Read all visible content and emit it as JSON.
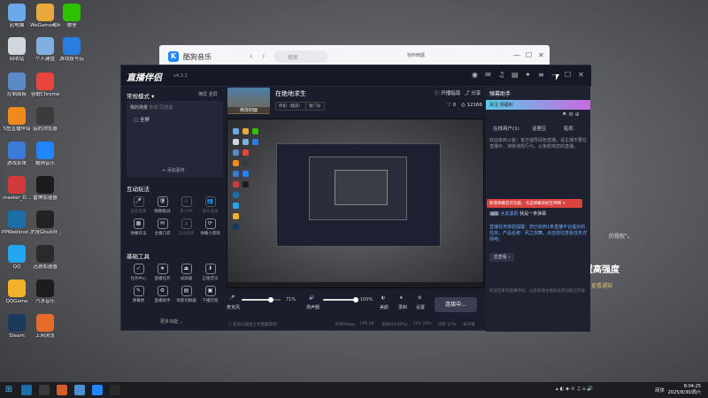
{
  "desktop_icons": [
    {
      "label": "此电脑",
      "icon": "computer-icon",
      "color": "#6aa9e9"
    },
    {
      "label": "WeGame都网专版",
      "icon": "wegame-icon",
      "color": "#e9a83a"
    },
    {
      "label": "微信",
      "icon": "wechat-icon",
      "color": "#2dc100"
    },
    {
      "label": "回收站",
      "icon": "recycle-bin-icon",
      "color": "#cfd6de"
    },
    {
      "label": "个人建盘",
      "icon": "folder-icon",
      "color": "#7fb0e0"
    },
    {
      "label": "游戏租号玩",
      "icon": "rent-game-icon",
      "color": "#2a7de1"
    },
    {
      "label": "控制面板",
      "icon": "control-panel-icon",
      "color": "#5b8ac9"
    },
    {
      "label": "谷歌Chrome",
      "icon": "chrome-icon",
      "color": "#e8453c"
    },
    {
      "label": "S鱼直播伴侣",
      "icon": "douyu-icon",
      "color": "#f08a1d"
    },
    {
      "label": "猎豹浏览器",
      "icon": "browser-icon",
      "color": "#3b3b3b"
    },
    {
      "label": "游戏菜单",
      "icon": "game-menu-icon",
      "color": "#3a7ad9"
    },
    {
      "label": "酷狗音乐",
      "icon": "kugou-icon",
      "color": "#1f86ff"
    },
    {
      "label": "master_D...",
      "icon": "master-icon",
      "color": "#d23b3b"
    },
    {
      "label": "雷神加速器",
      "icon": "leishen-icon",
      "color": "#1b1b1b"
    },
    {
      "label": "PPWeblinst...",
      "icon": "steam-icon",
      "color": "#1b6fa8"
    },
    {
      "label": "罗技Ghub补丁",
      "icon": "ghub-icon",
      "color": "#222"
    },
    {
      "label": "QQ",
      "icon": "qq-icon",
      "color": "#23a6f0"
    },
    {
      "label": "迅游加速器",
      "icon": "xunyou-icon",
      "color": "#2a2a2a"
    },
    {
      "label": "QQGame",
      "icon": "qqgame-icon",
      "color": "#f1b12b"
    },
    {
      "label": "汽水音乐",
      "icon": "qishui-icon",
      "color": "#1c1c1c"
    },
    {
      "label": "Steam",
      "icon": "steam-icon",
      "color": "#1a3a5c"
    },
    {
      "label": "上网浏览",
      "icon": "globe-icon",
      "color": "#e96b2b"
    }
  ],
  "kugou": {
    "title": "酷狗音乐",
    "search_placeholder": "搜索",
    "user": "怡吟西瑟",
    "back": "‹",
    "forward": "›",
    "refresh": "↻"
  },
  "bg_fragments": {
    "big": "置高强度",
    "small1": "的授权\"。",
    "small2": "查看通知"
  },
  "app": {
    "brand": "直播伴侣",
    "version": "v4.3.2",
    "mode": "常规模式 ▾",
    "mode_tabs": "横屏  竖屏",
    "scene_tab": "我的场景",
    "scene_tab2": "新增  同游选",
    "fullscreen": "全屏",
    "add_source": "+ 添加素材",
    "interact_title": "互动玩法",
    "interact": [
      {
        "icon": "🎤",
        "label": "语音连麦",
        "dim": true
      },
      {
        "icon": "🛡",
        "label": "畅聊挑战",
        "dim": false
      },
      {
        "icon": "⚔",
        "label": "多人PK",
        "dim": true
      },
      {
        "icon": "👥",
        "label": "观众连线",
        "dim": true
      },
      {
        "icon": "▦",
        "label": "弹幕玩法",
        "dim": false
      },
      {
        "icon": "✉",
        "label": "主播口袋",
        "dim": false
      },
      {
        "icon": "⌂",
        "label": "口头任务",
        "dim": true
      },
      {
        "icon": "⟳",
        "label": "弹幕小游戏",
        "dim": false
      }
    ],
    "tools_title": "基础工具",
    "tools": [
      {
        "icon": "✓",
        "label": "任务中心"
      },
      {
        "icon": "★",
        "label": "直播任务"
      },
      {
        "icon": "⏏",
        "label": "录屏器"
      },
      {
        "icon": "⬇",
        "label": "正版音乐"
      },
      {
        "icon": "✎",
        "label": "弹幕秀"
      },
      {
        "icon": "⚙",
        "label": "直播助手"
      },
      {
        "icon": "▤",
        "label": "场景切换器"
      },
      {
        "icon": "▣",
        "label": "下播历程"
      }
    ],
    "more": "更多功能 ⌄",
    "thumb_label": "修改封面",
    "game_name": "在绝地求生",
    "tags": [
      "折扣（端游）",
      "独门号"
    ],
    "header_right": {
      "start": "开播指南",
      "share": "分享",
      "likes": "0",
      "views": "12166"
    },
    "controls": {
      "mic_label": "麦克风",
      "mic_value": "71%",
      "speaker_label": "扬声器",
      "speaker_value": "100%",
      "beauty": "美颜",
      "record": "录制",
      "settings": "设置",
      "connect": "连接中..."
    },
    "status": {
      "left": "您可以直接上手直播游戏！",
      "bitrate": "码率0kbps",
      "fps": "FPS 28",
      "dropped": "丢帧0(0.00%)",
      "cpu": "CPU 25%",
      "mem": "内存 27%",
      "net": "未开播"
    }
  },
  "right_panel": {
    "title": "弹幕助手",
    "banner": "关注 领福利",
    "tabs": [
      "在线用户(1)",
      "话匣区",
      "贴彩"
    ],
    "msg1": "欢迎来到斗鱼！官方倡导绿色直播，请主播不要在直播中，演练违规行为，以免影响您的直播。",
    "redtip": "新增弹幕首页功能，点击弹幕添加至神网 ✕",
    "user_level": "LV2",
    "user_name": "水友黑豹",
    "user_msg": "我是一条弹幕",
    "sys": "直播任务体验提醒：您已收到1条直播平台提示的任务，产品名称：风之剑舞，点击前往查看任务详情吧。",
    "see_btn": "去查看 ›",
    "foot": "欢迎您来到直播伴侣，以及新增主播权益等功能已开放"
  },
  "taskbar": {
    "time": "8:04:25",
    "date": "2025/8/30/周六",
    "lang": "简体"
  }
}
